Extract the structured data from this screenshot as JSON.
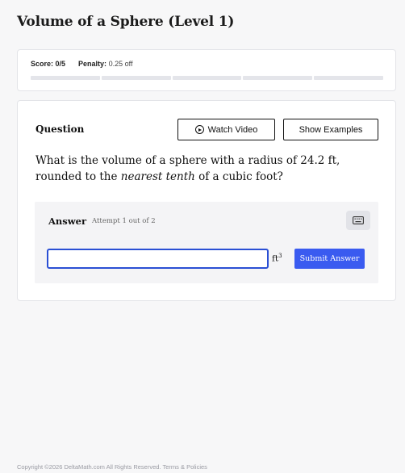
{
  "header": {
    "title": "Volume of a Sphere (Level 1)"
  },
  "score": {
    "score_label": "Score:",
    "score_value": "0/5",
    "penalty_label": "Penalty:",
    "penalty_value": "0.25 off",
    "segments": 5
  },
  "question": {
    "label": "Question",
    "watch_video_label": "Watch Video",
    "show_examples_label": "Show Examples",
    "text_before": "What is the volume of a sphere with a radius of 24.2 ft, rounded to the ",
    "text_emphasis": "nearest tenth",
    "text_after": " of a cubic foot?"
  },
  "answer": {
    "label": "Answer",
    "attempt": "Attempt 1 out of 2",
    "input_value": "",
    "unit": "ft",
    "unit_exponent": "3",
    "submit_label": "Submit Answer"
  },
  "footer": {
    "copyright": "Copyright ©2026 DeltaMath.com All Rights Reserved.",
    "terms_link": "Terms & Policies"
  },
  "colors": {
    "accent": "#3a5bf0",
    "input_border": "#2a4fd4"
  },
  "icons": {
    "video": "play-circle-icon",
    "keyboard": "keyboard-icon"
  }
}
